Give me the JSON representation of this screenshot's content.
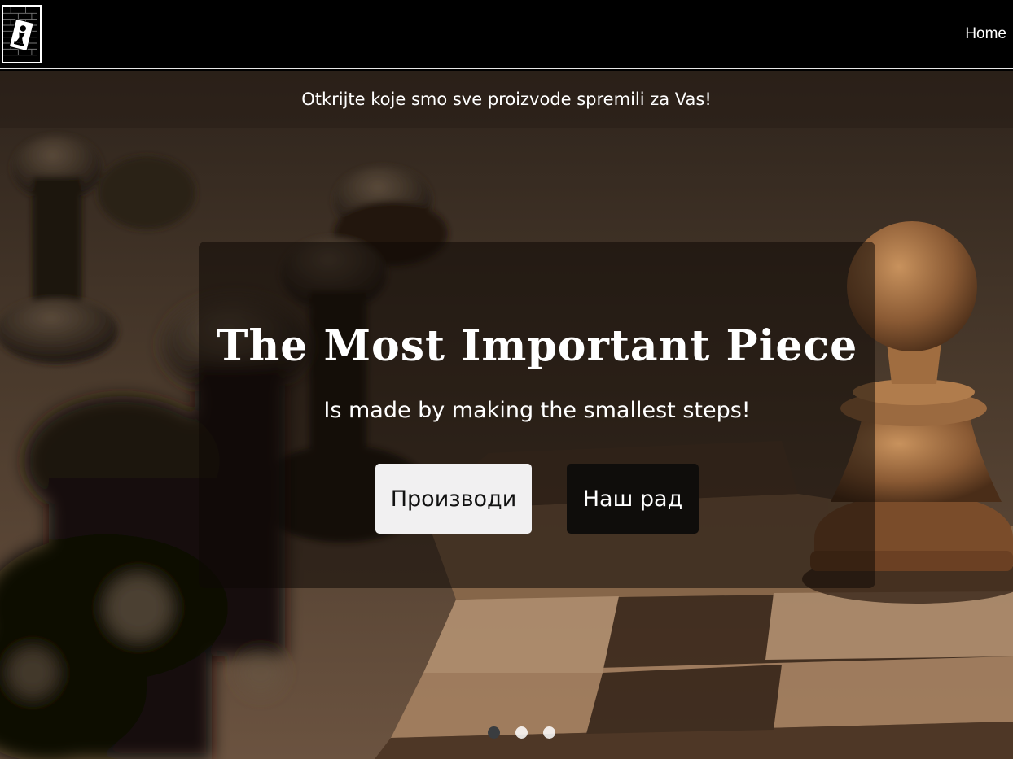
{
  "nav": {
    "home_label": "Home"
  },
  "banner": {
    "text": "Otkrijte koje smo sve proizvode spremili za Vas!"
  },
  "hero": {
    "title": "The Most Important Piece",
    "subtitle": "Is made by making the smallest steps!",
    "primary_button": "Производи",
    "secondary_button": "Наш рад",
    "slides": 3,
    "active_slide": 1
  },
  "colors": {
    "nav_bg": "#000000",
    "light_button": "#f1f0f1",
    "dark_button": "#0f0d0b",
    "active_dot": "#3a3d40"
  },
  "icons": {
    "logo": "chess-pawn-logo-icon"
  }
}
